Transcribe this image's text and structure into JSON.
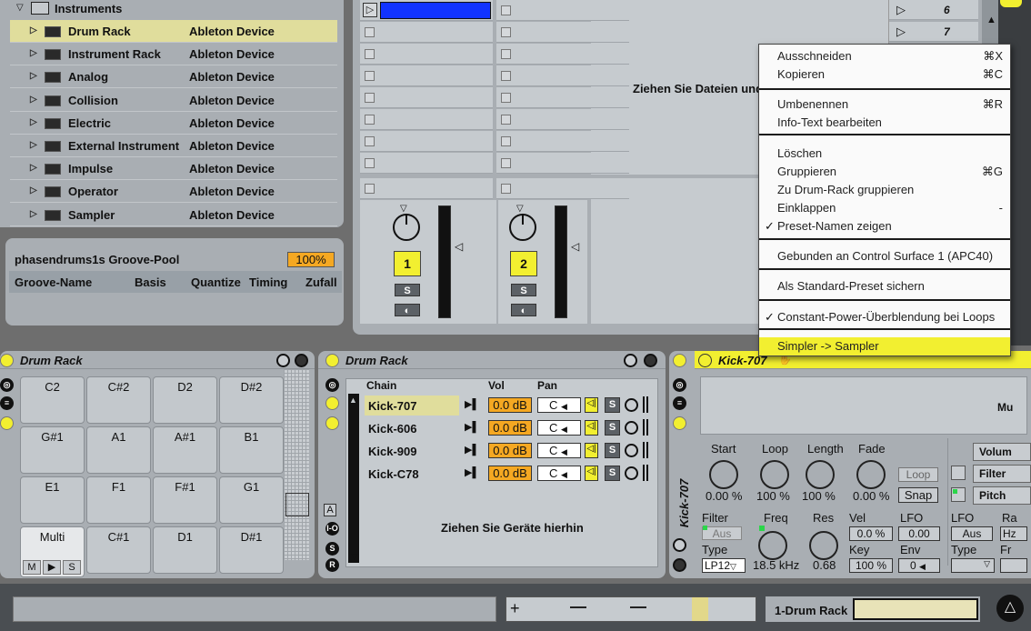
{
  "browser": {
    "folder": "Instruments",
    "items": [
      {
        "name": "Drum Rack",
        "source": "Ableton Device"
      },
      {
        "name": "Instrument Rack",
        "source": "Ableton Device"
      },
      {
        "name": "Analog",
        "source": "Ableton Device"
      },
      {
        "name": "Collision",
        "source": "Ableton Device"
      },
      {
        "name": "Electric",
        "source": "Ableton Device"
      },
      {
        "name": "External Instrument",
        "source": "Ableton Device"
      },
      {
        "name": "Impulse",
        "source": "Ableton Device"
      },
      {
        "name": "Operator",
        "source": "Ableton Device"
      },
      {
        "name": "Sampler",
        "source": "Ableton Device"
      }
    ]
  },
  "groove_pool": {
    "title": "phasendrums1s Groove-Pool",
    "percent": "100%",
    "columns": [
      "Groove-Name",
      "Basis",
      "Quantize",
      "Timing",
      "Zufall"
    ]
  },
  "session": {
    "drop_text": "Ziehen Sie Dateien und",
    "scenes": [
      "6",
      "7"
    ],
    "tracks": [
      {
        "number": "1",
        "solo": "S"
      },
      {
        "number": "2",
        "solo": "S"
      }
    ]
  },
  "context_menu": {
    "items": [
      {
        "label": "Ausschneiden",
        "shortcut": "⌘X"
      },
      {
        "label": "Kopieren",
        "shortcut": "⌘C"
      },
      {
        "label": "Umbenennen",
        "shortcut": "⌘R"
      },
      {
        "label": "Info-Text bearbeiten",
        "shortcut": ""
      },
      {
        "label": "Löschen",
        "shortcut": ""
      },
      {
        "label": "Gruppieren",
        "shortcut": "⌘G"
      },
      {
        "label": "Zu Drum-Rack gruppieren",
        "shortcut": ""
      },
      {
        "label": "Einklappen",
        "shortcut": "-"
      },
      {
        "label": "Preset-Namen zeigen",
        "shortcut": "",
        "checked": true
      },
      {
        "label": "Gebunden an Control Surface 1 (APC40)",
        "shortcut": ""
      },
      {
        "label": "Als Standard-Preset sichern",
        "shortcut": ""
      },
      {
        "label": "Constant-Power-Überblendung bei Loops",
        "shortcut": "",
        "checked": true
      },
      {
        "label": "Simpler -> Sampler",
        "shortcut": "",
        "highlighted": true
      }
    ]
  },
  "drum_rack_pads": {
    "title": "Drum Rack",
    "pads": [
      "C2",
      "C#2",
      "D2",
      "D#2",
      "G#1",
      "A1",
      "A#1",
      "B1",
      "E1",
      "F1",
      "F#1",
      "G1",
      "Multi",
      "C#1",
      "D1",
      "D#1"
    ],
    "pad_buttons": [
      "M",
      "▶",
      "S"
    ],
    "side_buttons": [
      "A",
      "I-O",
      "S",
      "R"
    ]
  },
  "chain_list": {
    "title": "Drum Rack",
    "headers": {
      "chain": "Chain",
      "vol": "Vol",
      "pan": "Pan"
    },
    "chains": [
      {
        "name": "Kick-707",
        "vol": "0.0 dB",
        "pan": "C"
      },
      {
        "name": "Kick-606",
        "vol": "0.0 dB",
        "pan": "C"
      },
      {
        "name": "Kick-909",
        "vol": "0.0 dB",
        "pan": "C"
      },
      {
        "name": "Kick-C78",
        "vol": "0.0 dB",
        "pan": "C"
      }
    ],
    "drop_text": "Ziehen Sie Geräte hierhin"
  },
  "simpler": {
    "title": "Kick-707",
    "vertical_title": "Kick-707",
    "waveform_label": "Mu",
    "params": [
      {
        "label": "Start",
        "value": "0.00 %"
      },
      {
        "label": "Loop",
        "value": "100 %"
      },
      {
        "label": "Length",
        "value": "100 %"
      },
      {
        "label": "Fade",
        "value": "0.00 %"
      }
    ],
    "loop_btn": "Loop",
    "snap_btn": "Snap",
    "right_btns": [
      "Volum",
      "Filter",
      "Pitch"
    ],
    "filter": {
      "label": "Filter",
      "toggle": "Aus",
      "type_label": "Type",
      "type": "LP12"
    },
    "freq": {
      "label": "Freq",
      "value": "18.5 kHz"
    },
    "res": {
      "label": "Res",
      "value": "0.68"
    },
    "vel": {
      "label": "Vel",
      "value": "0.0 %"
    },
    "key": {
      "label": "Key",
      "value": "100 %"
    },
    "lfo": {
      "label": "LFO",
      "value": "0.00"
    },
    "env": {
      "label": "Env",
      "value": "0"
    },
    "lfo2": {
      "label": "LFO",
      "toggle": "Aus",
      "type_label": "Type"
    },
    "ra": "Ra",
    "fr": "Fr",
    "hz": "Hz"
  },
  "status_bar": {
    "track_name": "1-Drum Rack"
  }
}
